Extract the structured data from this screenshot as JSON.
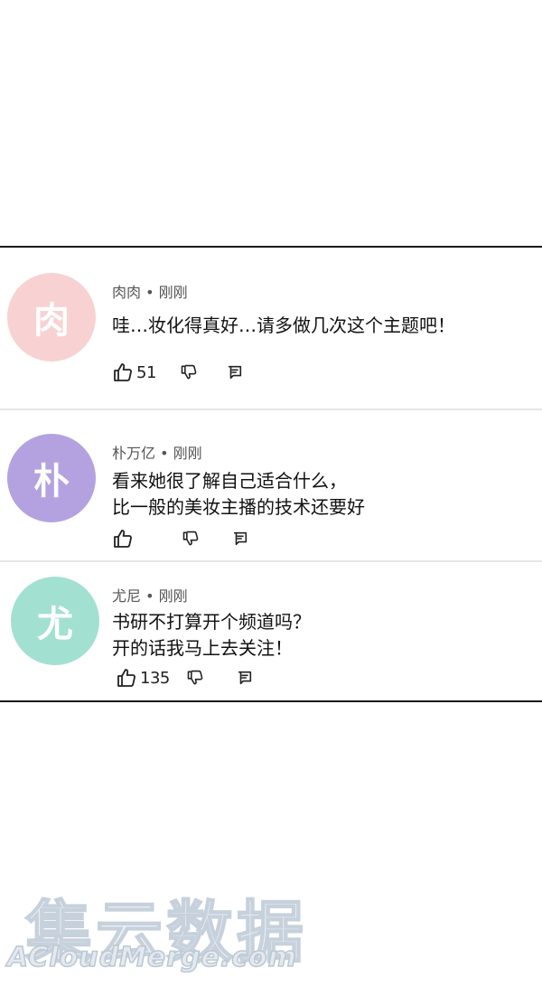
{
  "comments": [
    {
      "avatar_char": "肉",
      "avatar_color": "#f8d2d2",
      "meta": "肉肉 • 刚刚",
      "lines": [
        "哇…妆化得真好…请多做几次这个主题吧！"
      ],
      "likes": "51"
    },
    {
      "avatar_char": "朴",
      "avatar_color": "#b4a2e0",
      "meta": "朴万亿 • 刚刚",
      "lines": [
        "看来她很了解自己适合什么，",
        "比一般的美妆主播的技术还要好"
      ],
      "likes": ""
    },
    {
      "avatar_char": "尤",
      "avatar_color": "#a2e0d2",
      "meta": "尤尼 • 刚刚",
      "lines": [
        "书研不打算开个频道吗？",
        "开的话我马上去关注！"
      ],
      "likes": "135"
    }
  ],
  "icons": {
    "like": "thumbs-up-icon",
    "dislike": "thumbs-down-icon",
    "reply": "reply-icon"
  },
  "watermark": {
    "chinese": "集云数据",
    "english": "ACloudMerge.com"
  }
}
